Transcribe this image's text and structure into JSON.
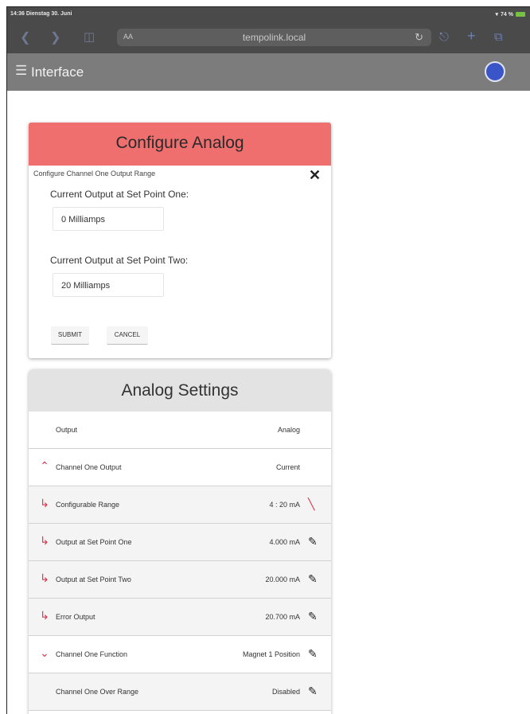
{
  "status_bar": {
    "time": "14:36  Dienstag 30. Juni",
    "battery": "74 %"
  },
  "browser": {
    "text_size_label": "AA",
    "url": "tempolink.local",
    "icons": [
      "back-icon",
      "forward-icon",
      "bookmarks-icon",
      "reload-icon",
      "share-icon",
      "add-icon",
      "tabs-icon"
    ]
  },
  "app_bar": {
    "title": "Interface",
    "menu_icon": "hamburger-menu-icon"
  },
  "configure_card": {
    "title": "Configure Analog",
    "subtitle": "Configure Channel One Output Range",
    "field1_label": "Current Output at Set Point One:",
    "field1_value": "0 Milliamps",
    "field2_label": "Current Output at Set Point Two:",
    "field2_value": "20 Milliamps",
    "submit_label": "SUBMIT",
    "cancel_label": "CANCEL"
  },
  "settings_card": {
    "title": "Analog Settings",
    "rows": [
      {
        "name": "Output",
        "value": "Analog",
        "icon": "",
        "action": ""
      },
      {
        "name": "Channel One Output",
        "value": "Current",
        "icon": "chevron-up-icon",
        "action": ""
      },
      {
        "name": "Configurable Range",
        "value": "4 : 20 mA",
        "icon": "sub-item-arrow-icon",
        "action": "edit-off-icon"
      },
      {
        "name": "Output at Set Point One",
        "value": "4.000 mA",
        "icon": "sub-item-arrow-icon",
        "action": "edit-icon"
      },
      {
        "name": "Output at Set Point Two",
        "value": "20.000 mA",
        "icon": "sub-item-arrow-icon",
        "action": "edit-icon"
      },
      {
        "name": "Error Output",
        "value": "20.700 mA",
        "icon": "sub-item-arrow-icon",
        "action": "edit-icon"
      },
      {
        "name": "Channel One Function",
        "value": "Magnet 1 Position",
        "icon": "chevron-down-icon",
        "action": "edit-icon"
      },
      {
        "name": "Channel One Over Range",
        "value": "Disabled",
        "icon": "",
        "action": "edit-icon"
      }
    ]
  },
  "colors": {
    "accent": "#d8354f",
    "header_red": "#ef6f6f",
    "app_bar": "#7c7c7c",
    "browser_bar": "#4a4a4a",
    "avatar": "#3a55c8"
  }
}
